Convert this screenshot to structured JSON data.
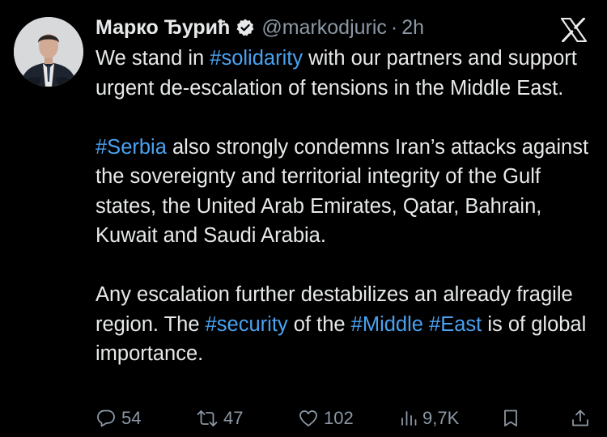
{
  "author": {
    "name": "Марко Ђурић",
    "handle": "@markodjuric",
    "separator": "·",
    "time": "2h"
  },
  "tweet": {
    "paragraphs": [
      [
        {
          "text": "We stand in ",
          "hashtag": false
        },
        {
          "text": "#solidarity",
          "hashtag": true
        },
        {
          "text": " with our partners and support urgent de-escalation of tensions in the Middle East.",
          "hashtag": false
        }
      ],
      [
        {
          "text": "#Serbia",
          "hashtag": true
        },
        {
          "text": " also strongly condemns Iran’s attacks against the sovereignty and territorial integrity of the Gulf states, the United Arab Emirates, Qatar, Bahrain, Kuwait and Saudi Arabia.",
          "hashtag": false
        }
      ],
      [
        {
          "text": "Any escalation further destabilizes an already fragile region. The ",
          "hashtag": false
        },
        {
          "text": "#security",
          "hashtag": true
        },
        {
          "text": " of the ",
          "hashtag": false
        },
        {
          "text": "#Middle",
          "hashtag": true
        },
        {
          "text": " ",
          "hashtag": false
        },
        {
          "text": "#East",
          "hashtag": true
        },
        {
          "text": " is of global importance.",
          "hashtag": false
        }
      ]
    ]
  },
  "actions": {
    "replies": "54",
    "reposts": "47",
    "likes": "102",
    "views": "9,7K"
  },
  "icons": {
    "verified": "verified-badge-icon",
    "logo": "x-logo-icon",
    "reply": "reply-icon",
    "repost": "repost-icon",
    "like": "heart-icon",
    "views": "views-icon",
    "bookmark": "bookmark-icon",
    "share": "share-icon"
  },
  "colors": {
    "background": "#000000",
    "text": "#e7e9ea",
    "muted": "#8b98a5",
    "hashtag": "#4aa1ef"
  }
}
